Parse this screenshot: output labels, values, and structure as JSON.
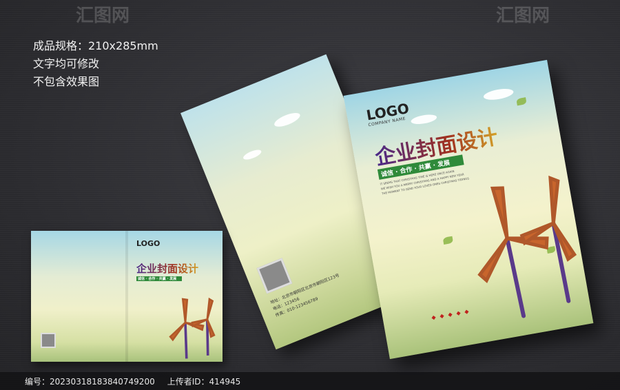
{
  "specs": [
    "成品规格：210x285mm",
    "文字均可修改",
    "不包含效果图"
  ],
  "cover": {
    "logo": "LOGO",
    "company": "COMPANY NAME",
    "title": "企业封面设计",
    "slogan": "诚信 · 合作 · 共赢 · 发展",
    "english": [
      "IT SEEMS THAT CHRISTMAS TIME IS HERE ONCE AGAIN",
      "WE WISH YOU A MERRY CHRISTMAS AND A HAPPY NEW YEAR",
      "THE MOMENT TO SEND YOUR LOVED ONES CHRISTMAS TIDINGS"
    ]
  },
  "back": {
    "qr_label": "二维码",
    "address": [
      "地址：北京市朝阳区北京市朝阳区123号",
      "电话：123456",
      "传真：010-123456789"
    ]
  },
  "footer": {
    "id_label": "编号：",
    "id_value": "20230318183840749200",
    "uploader_label": "上传者ID：",
    "uploader_value": "414945"
  },
  "watermark": "汇图网",
  "colors": {
    "accent_green": "#2f8a3a",
    "title_red": "#a0301f",
    "turbine": "#b0582a"
  }
}
